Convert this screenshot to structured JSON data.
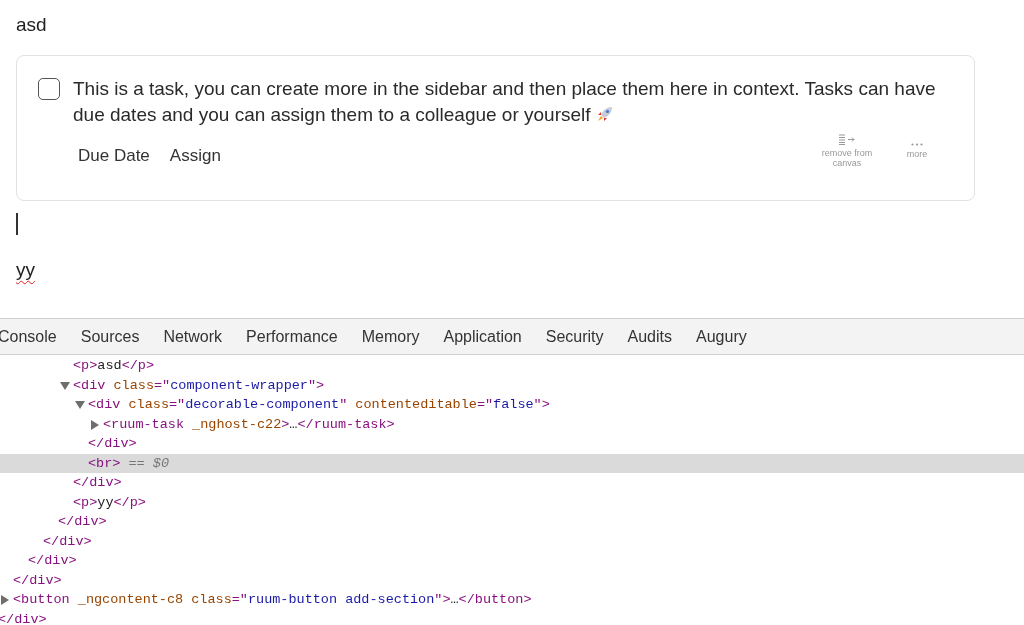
{
  "page": {
    "paragraph_top": "asd",
    "task": {
      "checked": false,
      "text": "This is a task, you can create more in the sidebar and then place them here in context. Tasks can have due dates and you can assign them to a colleague or yourself",
      "buttons": [
        "Due Date",
        "Assign"
      ],
      "actions": [
        {
          "kind": "remove",
          "label": "remove from canvas"
        },
        {
          "kind": "more",
          "label": "more"
        }
      ]
    },
    "paragraph_bottom": {
      "text": "yy",
      "misspelled": true
    }
  },
  "devtools": {
    "tabs": [
      "Console",
      "Sources",
      "Network",
      "Performance",
      "Memory",
      "Application",
      "Security",
      "Audits",
      "Augury"
    ],
    "tree": [
      {
        "children": [
          {
            "children": [
              {
                "children": [
                  {
                    "children": [
                      {
                        "children": [
                          {
                            "tokens": [
                              {
                                "kind": "tag",
                                "text": "<p>"
                              },
                              {
                                "kind": "text",
                                "text": "asd"
                              },
                              {
                                "kind": "tag",
                                "text": "</p>"
                              }
                            ]
                          },
                          {
                            "expanded": true,
                            "tokens": [
                              {
                                "kind": "tag",
                                "text": "<div"
                              },
                              {
                                "kind": "attr",
                                "text": " class"
                              },
                              {
                                "kind": "tag",
                                "text": "=\""
                              },
                              {
                                "kind": "value",
                                "text": "component-wrapper"
                              },
                              {
                                "kind": "tag",
                                "text": "\">"
                              }
                            ],
                            "children": [
                              {
                                "expanded": true,
                                "tokens": [
                                  {
                                    "kind": "tag",
                                    "text": "<div"
                                  },
                                  {
                                    "kind": "attr",
                                    "text": " class"
                                  },
                                  {
                                    "kind": "tag",
                                    "text": "=\""
                                  },
                                  {
                                    "kind": "value",
                                    "text": "decorable-component"
                                  },
                                  {
                                    "kind": "tag",
                                    "text": "\""
                                  },
                                  {
                                    "kind": "attr",
                                    "text": " contenteditable"
                                  },
                                  {
                                    "kind": "tag",
                                    "text": "=\""
                                  },
                                  {
                                    "kind": "value",
                                    "text": "false"
                                  },
                                  {
                                    "kind": "tag",
                                    "text": "\">"
                                  }
                                ],
                                "children": [
                                  {
                                    "expanded": false,
                                    "tokens": [
                                      {
                                        "kind": "tag",
                                        "text": "<ruum-task"
                                      },
                                      {
                                        "kind": "attr",
                                        "text": " _nghost-c22"
                                      },
                                      {
                                        "kind": "tag",
                                        "text": ">"
                                      },
                                      {
                                        "kind": "text",
                                        "text": "…"
                                      },
                                      {
                                        "kind": "tag",
                                        "text": "</ruum-task>"
                                      }
                                    ]
                                  }
                                ]
                              },
                              {
                                "tokens": [
                                  {
                                    "kind": "tag",
                                    "text": "</div>"
                                  }
                                ]
                              },
                              {
                                "selected": true,
                                "tokens": [
                                  {
                                    "kind": "tag",
                                    "text": "<br>"
                                  },
                                  {
                                    "kind": "marker",
                                    "text": " == $0"
                                  }
                                ]
                              }
                            ]
                          },
                          {
                            "tokens": [
                              {
                                "kind": "tag",
                                "text": "</div>"
                              }
                            ]
                          },
                          {
                            "tokens": [
                              {
                                "kind": "tag",
                                "text": "<p>"
                              },
                              {
                                "kind": "text",
                                "text": "yy"
                              },
                              {
                                "kind": "tag",
                                "text": "</p>"
                              }
                            ]
                          }
                        ]
                      },
                      {
                        "tokens": [
                          {
                            "kind": "tag",
                            "text": "</div>"
                          }
                        ]
                      }
                    ]
                  },
                  {
                    "tokens": [
                      {
                        "kind": "tag",
                        "text": "</div>"
                      }
                    ]
                  }
                ]
              },
              {
                "tokens": [
                  {
                    "kind": "tag",
                    "text": "</div>"
                  }
                ]
              }
            ]
          },
          {
            "tokens": [
              {
                "kind": "tag",
                "text": "</div>"
              }
            ]
          },
          {
            "expanded": false,
            "tokens": [
              {
                "kind": "tag",
                "text": "<button"
              },
              {
                "kind": "attr",
                "text": " _ngcontent-c8 class"
              },
              {
                "kind": "tag",
                "text": "=\""
              },
              {
                "kind": "value",
                "text": "ruum-button add-section"
              },
              {
                "kind": "tag",
                "text": "\">"
              },
              {
                "kind": "text",
                "text": "…"
              },
              {
                "kind": "tag",
                "text": "</button>"
              }
            ]
          }
        ]
      },
      {
        "tokens": [
          {
            "kind": "tag",
            "text": "</div>"
          }
        ]
      }
    ]
  }
}
